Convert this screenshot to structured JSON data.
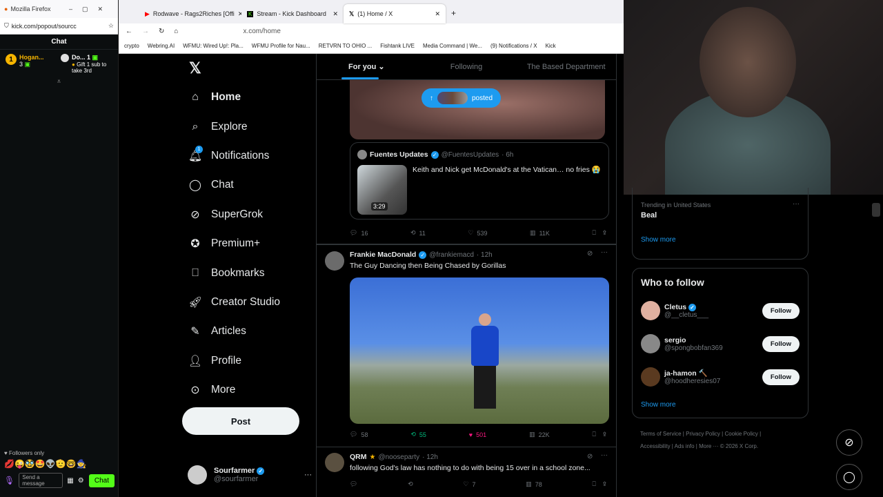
{
  "kick": {
    "browser_title": "Mozilla Firefox",
    "url": "kick.com/popout/sourcc",
    "panel_title": "Chat",
    "pin1_name": "Hogan...",
    "pin1_count": "3",
    "pin2_name": "Do...",
    "pin2_count": "1",
    "pin2_text": "Gift 1 sub to take 3rd",
    "followers_only": "Followers only",
    "send_placeholder": "Send a message",
    "chat_button": "Chat",
    "emojis": "💋😜🥸🤩👽🫡🤓🧙"
  },
  "browser": {
    "tabs": [
      {
        "label": "Rodwave - Rags2Riches [Offi",
        "icon": "youtube-icon"
      },
      {
        "label": "Stream - Kick Dashboard",
        "icon": "kick-icon"
      },
      {
        "label": "(1) Home / X",
        "icon": "x-icon"
      }
    ],
    "url": "x.com/home",
    "bookmarks": [
      "crypto",
      "Webring.AI",
      "WFMU: Wired Up!: Pla...",
      "WFMU Profile for Nau...",
      "RETVRN TO OHIO ...",
      "Fishtank LIVE",
      "Media Command | We...",
      "(9) Notifications / X",
      "Kick"
    ]
  },
  "xnav": {
    "items": [
      {
        "label": "Home",
        "icon": "home-icon"
      },
      {
        "label": "Explore",
        "icon": "search-icon"
      },
      {
        "label": "Notifications",
        "icon": "bell-icon"
      },
      {
        "label": "Chat",
        "icon": "chat-icon"
      },
      {
        "label": "SuperGrok",
        "icon": "grok-icon"
      },
      {
        "label": "Premium+",
        "icon": "premium-icon"
      },
      {
        "label": "Bookmarks",
        "icon": "bookmark-icon"
      },
      {
        "label": "Creator Studio",
        "icon": "rocket-icon"
      },
      {
        "label": "Articles",
        "icon": "article-icon"
      },
      {
        "label": "Profile",
        "icon": "person-icon"
      },
      {
        "label": "More",
        "icon": "more-icon"
      }
    ],
    "notif_badge": "1",
    "post_label": "Post",
    "account_name": "Sourfarmer",
    "account_handle": "@sourfarmer"
  },
  "feed": {
    "tabs": [
      "For you",
      "Following",
      "The Based Department"
    ],
    "posted_pill": "posted",
    "quote": {
      "name": "Fuentes Updates",
      "handle": "@FuentesUpdates",
      "time": "· 6h",
      "text": "Keith and Nick get McDonald's at the Vatican… no fries 😭",
      "duration": "3:29"
    },
    "tweet1_stats": {
      "replies": "16",
      "reposts": "11",
      "likes": "539",
      "views": "11K"
    },
    "tweet2": {
      "name": "Frankie MacDonald",
      "handle": "@frankiemacd",
      "time": "· 12h",
      "text": "The Guy Dancing then Being Chased by Gorillas",
      "replies": "58",
      "reposts": "55",
      "likes": "501",
      "views": "22K"
    },
    "tweet3": {
      "name": "QRM",
      "handle": "@nooseparty",
      "time": "· 12h",
      "text": "following God's law has nothing to do with being 15 over in a school zone...",
      "likes": "7",
      "views": "78"
    }
  },
  "sidebar": {
    "trending_label": "Trending in United States",
    "trending_topic": "Beal",
    "show_more": "Show more",
    "who_to_follow": "Who to follow",
    "follow_label": "Follow",
    "suggestions": [
      {
        "name": "Cletus",
        "handle": "@__cletus___"
      },
      {
        "name": "sergio",
        "handle": "@spongbobfan369"
      },
      {
        "name": "ja-hamon 🔨",
        "handle": "@hoodheresies07"
      }
    ],
    "footer_links": [
      "Terms of Service",
      "Privacy Policy",
      "Cookie Policy",
      "Accessibility",
      "Ads info",
      "More ···",
      "© 2026 X Corp."
    ]
  }
}
